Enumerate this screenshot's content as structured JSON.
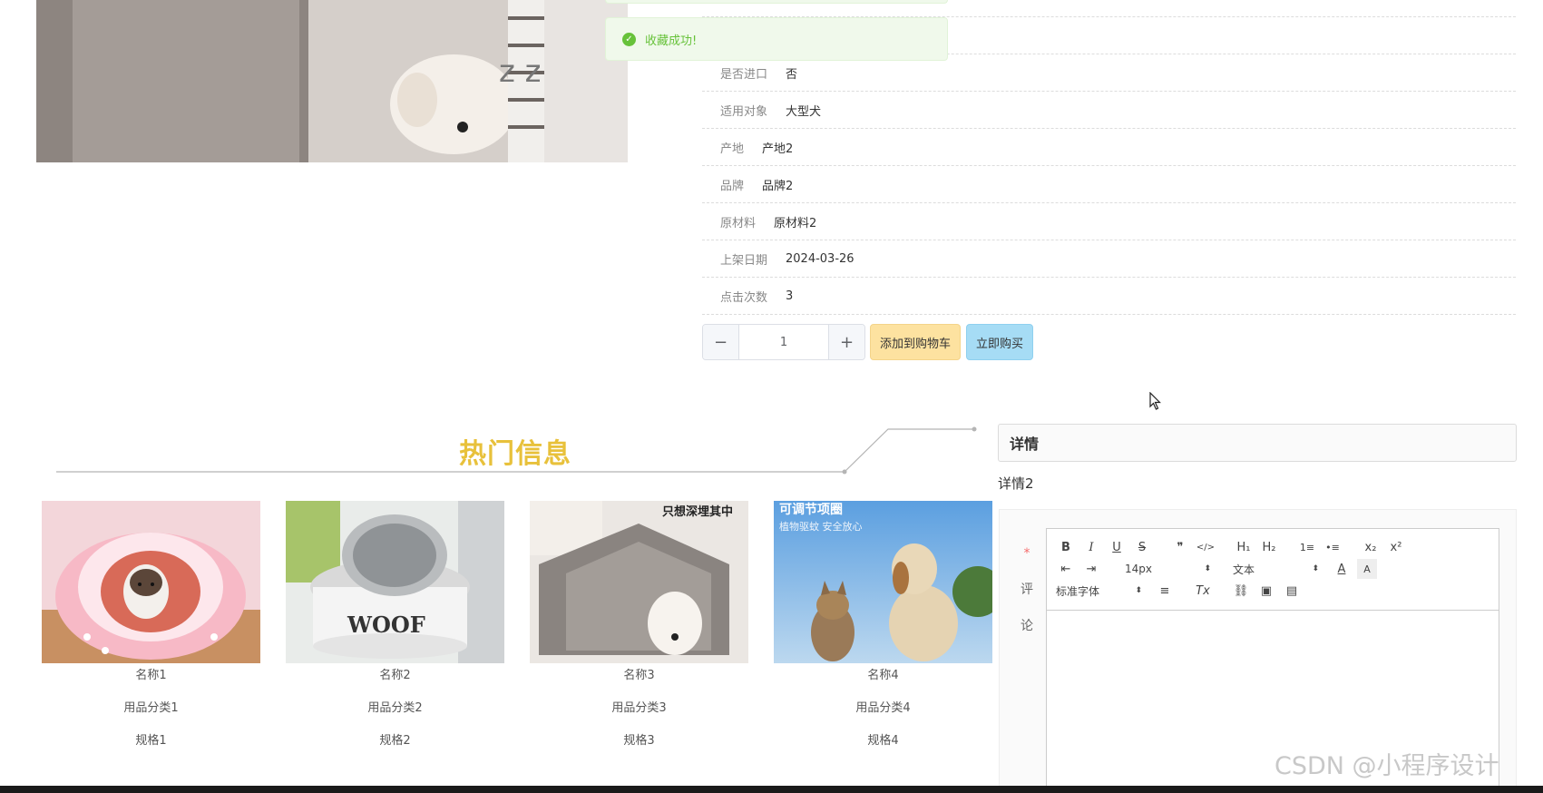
{
  "toast": {
    "message": "收藏成功!",
    "icon": "check-circle-icon"
  },
  "attributes": [
    {
      "key": "",
      "value": ""
    },
    {
      "key": "",
      "value": ""
    },
    {
      "key": "是否进口",
      "value": "否"
    },
    {
      "key": "适用对象",
      "value": "大型犬"
    },
    {
      "key": "产地",
      "value": "产地2"
    },
    {
      "key": "品牌",
      "value": "品牌2"
    },
    {
      "key": "原材料",
      "value": "原材料2"
    },
    {
      "key": "上架日期",
      "value": "2024-03-26"
    },
    {
      "key": "点击次数",
      "value": "3"
    }
  ],
  "purchase": {
    "minus_icon": "minus-icon",
    "plus_icon": "plus-icon",
    "quantity": "1",
    "add_to_cart": "添加到购物车",
    "buy_now": "立即购买"
  },
  "hot": {
    "title": "热门信息",
    "items": [
      {
        "name": "名称1",
        "category": "用品分类1",
        "spec": "规格1"
      },
      {
        "name": "名称2",
        "category": "用品分类2",
        "spec": "规格2"
      },
      {
        "name": "名称3",
        "category": "用品分类3",
        "spec": "规格3"
      },
      {
        "name": "名称4",
        "category": "用品分类4",
        "spec": "规格4"
      }
    ]
  },
  "detail": {
    "heading": "详情",
    "text": "详情2"
  },
  "comment": {
    "required_mark": "*",
    "label_1": "评",
    "label_2": "论",
    "toolbar": {
      "bold": "B",
      "italic": "I",
      "underline": "U",
      "strike": "S",
      "quote": "❞",
      "code": "</>",
      "h1": "H₁",
      "h2": "H₂",
      "ordered_list": "1≡",
      "bullet_list": "•≡",
      "subscript": "x₂",
      "superscript": "x²",
      "outdent": "⇤",
      "indent": "⇥",
      "size_value": "14px",
      "text_style_value": "文本",
      "color": "A",
      "background": "A",
      "font_value": "标准字体",
      "align": "≡",
      "clean": "Tx",
      "link": "⛓",
      "image": "▣",
      "video": "▤"
    }
  },
  "watermark": "CSDN @小程序设计",
  "colors": {
    "accent_title": "#e8c13b",
    "success": "#67c23a",
    "cart_button": "#fde2a0",
    "buy_button": "#a6dcf5"
  }
}
